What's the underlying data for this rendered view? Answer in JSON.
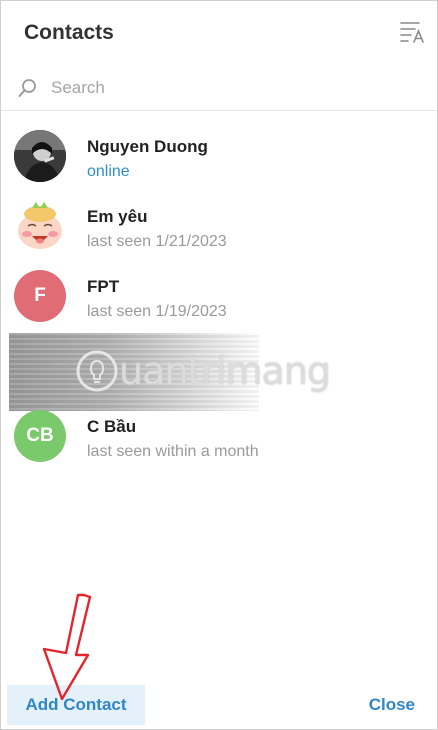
{
  "header": {
    "title": "Contacts",
    "sort_icon": "sort-alpha-icon"
  },
  "search": {
    "placeholder": "Search",
    "value": "",
    "icon": "search-icon"
  },
  "contacts": [
    {
      "name": "Nguyen Duong",
      "status": "online",
      "avatar_type": "photo"
    },
    {
      "name": "Em yêu",
      "status": "last seen 1/21/2023",
      "avatar_type": "sticker"
    },
    {
      "name": "FPT",
      "status": "last seen 1/19/2023",
      "avatar_type": "initials",
      "initials": "F",
      "avatar_color": "#e06c75"
    },
    {
      "name": "C Bầu",
      "status": "last seen within a month",
      "avatar_type": "initials",
      "initials": "CB",
      "avatar_color": "#7ac96b"
    }
  ],
  "watermark": {
    "text": "uantrimang"
  },
  "footer": {
    "add_label": "Add Contact",
    "close_label": "Close"
  },
  "colors": {
    "accent": "#2f87c8",
    "online": "#2f8ed0",
    "add_button_bg": "#e4f0fa",
    "annotation_arrow": "#e3262b"
  }
}
